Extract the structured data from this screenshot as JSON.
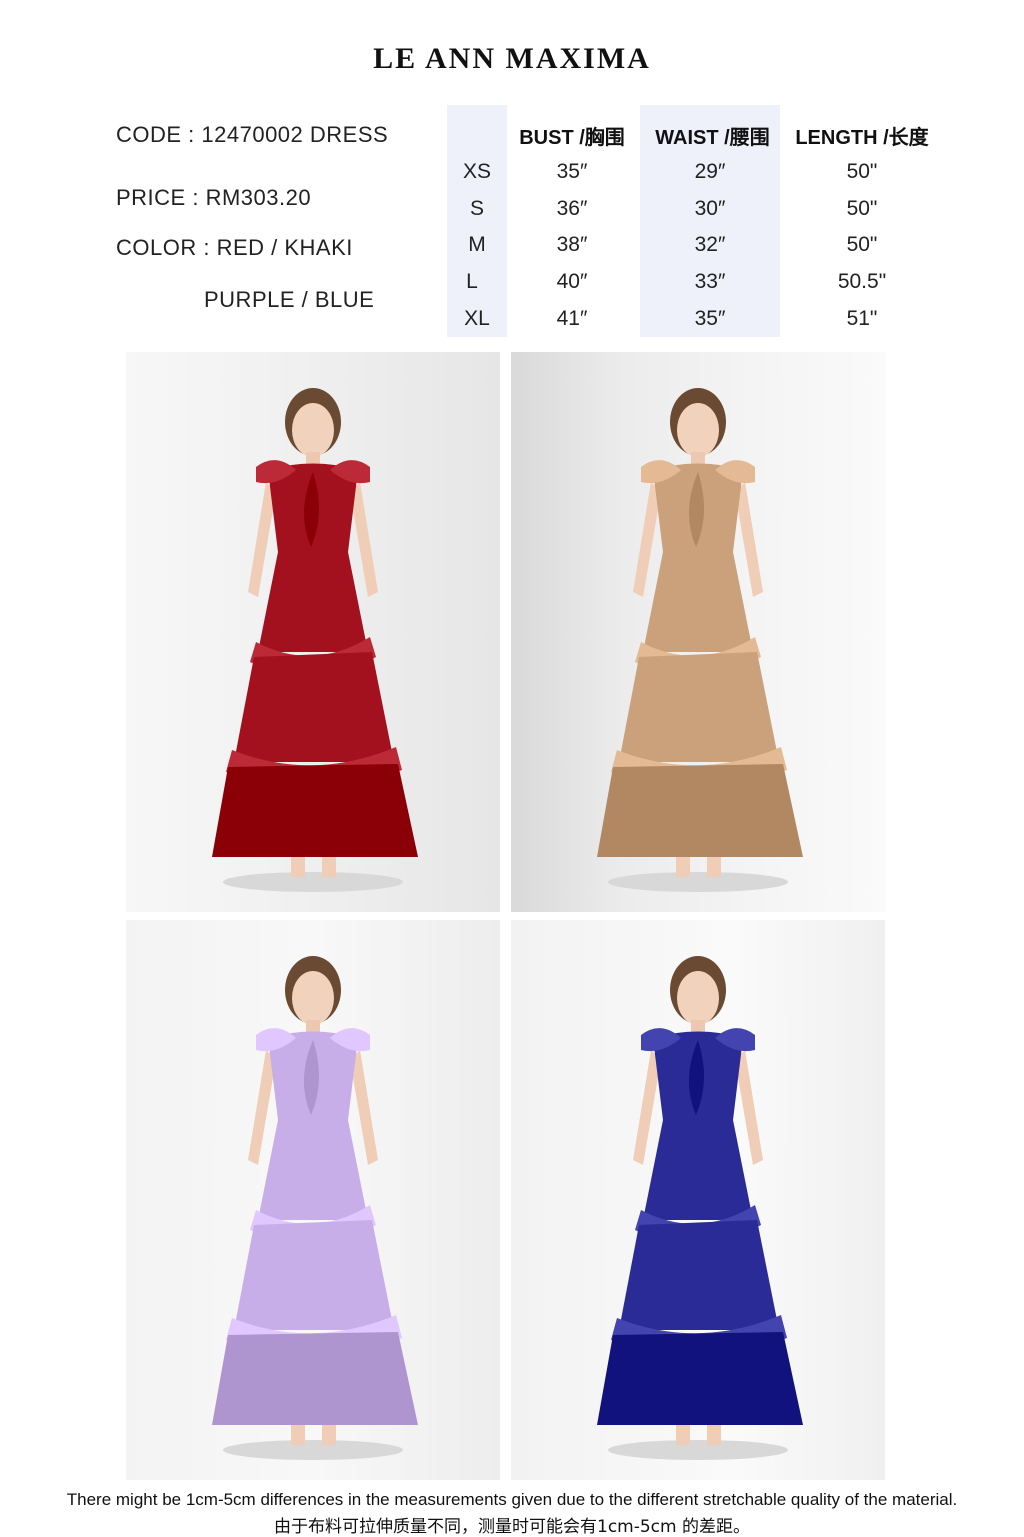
{
  "brand": "LE ANN MAXIMA",
  "product": {
    "code": "CODE : 12470002 DRESS",
    "price": "PRICE : RM303.20",
    "color_line1": "COLOR : RED / KHAKI",
    "color_line2": "PURPLE / BLUE"
  },
  "size_chart": {
    "headers": {
      "bust": "BUST /胸围",
      "waist": "WAIST /腰围",
      "length": "LENGTH /长度"
    },
    "rows": [
      {
        "size": "XS",
        "bust": "35″",
        "waist": "29″",
        "length": "50\""
      },
      {
        "size": "S",
        "bust": "36″",
        "waist": "30″",
        "length": "50\""
      },
      {
        "size": "M",
        "bust": "38″",
        "waist": "32″",
        "length": "50\""
      },
      {
        "size": "L",
        "bust": "40″",
        "waist": "33″",
        "length": "50.5\""
      },
      {
        "size": "XL",
        "bust": "41″",
        "waist": "35″",
        "length": "51\""
      }
    ]
  },
  "photos": [
    {
      "color": "#a3111f",
      "icon": "model-red-dress"
    },
    {
      "color": "#caa17a",
      "icon": "model-khaki-dress"
    },
    {
      "color": "#c8aee8",
      "icon": "model-purple-dress"
    },
    {
      "color": "#2a2b96",
      "icon": "model-blue-dress"
    }
  ],
  "footer": {
    "note_en": "There might be 1cm-5cm differences in the measurements given due to the different stretchable quality of the material.",
    "note_zh": "由于布料可拉伸质量不同，测量时可能会有1cm-5cm 的差距。"
  }
}
